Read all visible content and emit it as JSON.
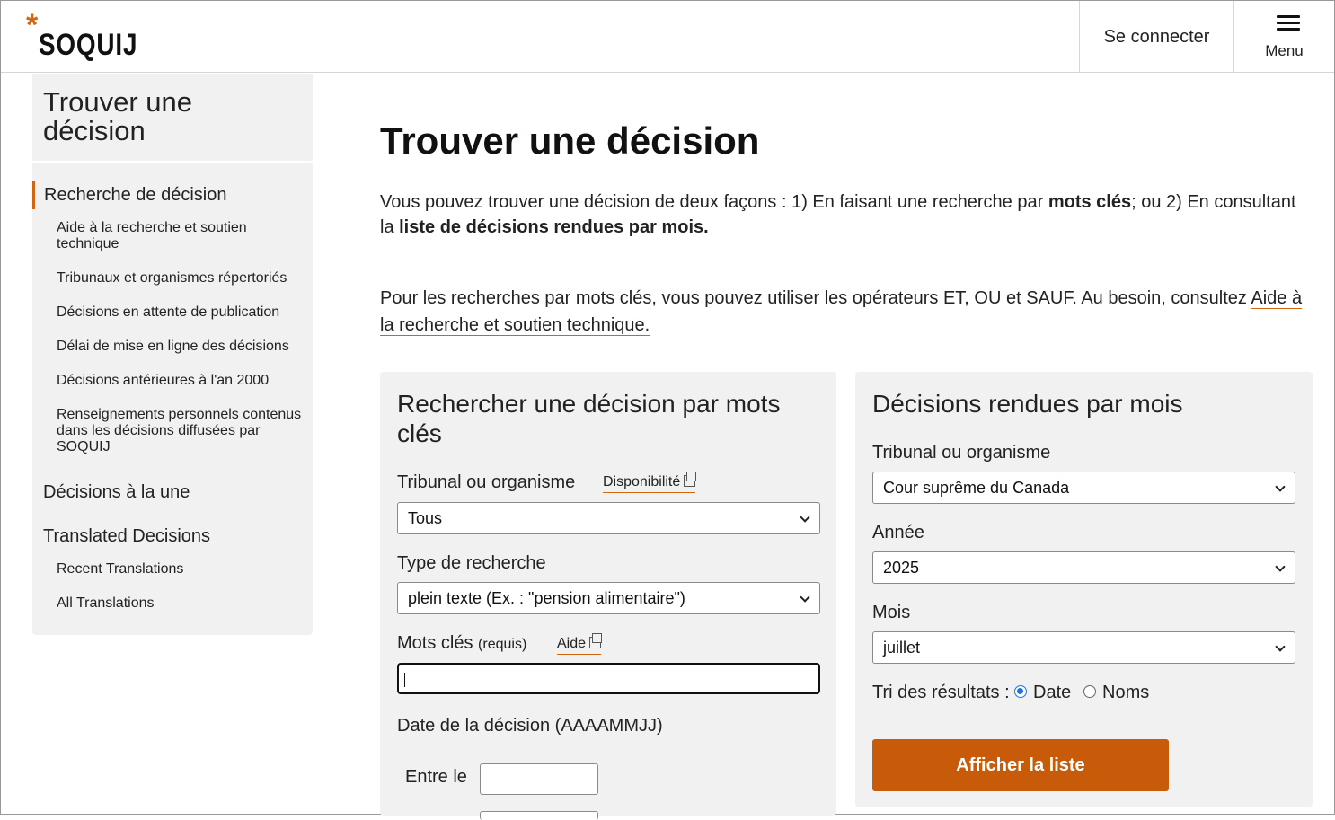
{
  "header": {
    "logo_star": "*",
    "logo_text": "SOQUIJ",
    "login_label": "Se connecter",
    "menu_label": "Menu"
  },
  "sidebar": {
    "title": "Trouver une décision",
    "items": [
      {
        "label": "Recherche de décision",
        "level": 1,
        "active": true
      },
      {
        "label": "Aide à la recherche et soutien technique",
        "level": 2
      },
      {
        "label": "Tribunaux et organismes répertoriés",
        "level": 2
      },
      {
        "label": "Décisions en attente de publication",
        "level": 2
      },
      {
        "label": "Délai de mise en ligne des décisions",
        "level": 2
      },
      {
        "label": "Décisions antérieures à l'an 2000",
        "level": 2
      },
      {
        "label": "Renseignements personnels contenus dans les décisions diffusées par SOQUIJ",
        "level": 2
      },
      {
        "label": "Décisions à la une",
        "level": 1
      },
      {
        "label": "Translated Decisions",
        "level": 1
      },
      {
        "label": "Recent Translations",
        "level": 2
      },
      {
        "label": "All Translations",
        "level": 2
      }
    ]
  },
  "main": {
    "title": "Trouver une décision",
    "intro": {
      "part1": "Vous pouvez trouver une décision de deux façons : 1) En faisant une recherche par ",
      "bold1": "mots clés",
      "part2": "; ou 2) En consultant la ",
      "bold2": "liste de décisions rendues par mois."
    },
    "para2": {
      "text": "Pour les recherches par mots clés, vous pouvez utiliser les opérateurs ET, OU et SAUF. Au besoin, consultez ",
      "link": "Aide à la recherche et soutien technique."
    }
  },
  "keyword_search": {
    "title": "Rechercher une décision par mots clés",
    "tribunal_label": "Tribunal ou organisme",
    "availability_link": "Disponibilité",
    "tribunal_value": "Tous",
    "search_type_label": "Type de recherche",
    "search_type_value": "plein texte (Ex. : \"pension alimentaire\")",
    "keywords_label": "Mots clés",
    "keywords_required": "(requis)",
    "help_link": "Aide",
    "keywords_value": "",
    "date_label": "Date de la décision (AAAAMMJJ)",
    "between_label": "Entre le",
    "between_value": ""
  },
  "monthly": {
    "title": "Décisions rendues par mois",
    "tribunal_label": "Tribunal ou organisme",
    "tribunal_value": "Cour suprême du Canada",
    "year_label": "Année",
    "year_value": "2025",
    "month_label": "Mois",
    "month_value": "juillet",
    "sort_label": "Tri des résultats :",
    "sort_options": [
      "Date",
      "Noms"
    ],
    "sort_selected": "Date",
    "submit_label": "Afficher la liste"
  },
  "colors": {
    "accent": "#d0660f",
    "button": "#c75b0a",
    "panel_bg": "#f1f1f1",
    "radio": "#1a73e8"
  }
}
